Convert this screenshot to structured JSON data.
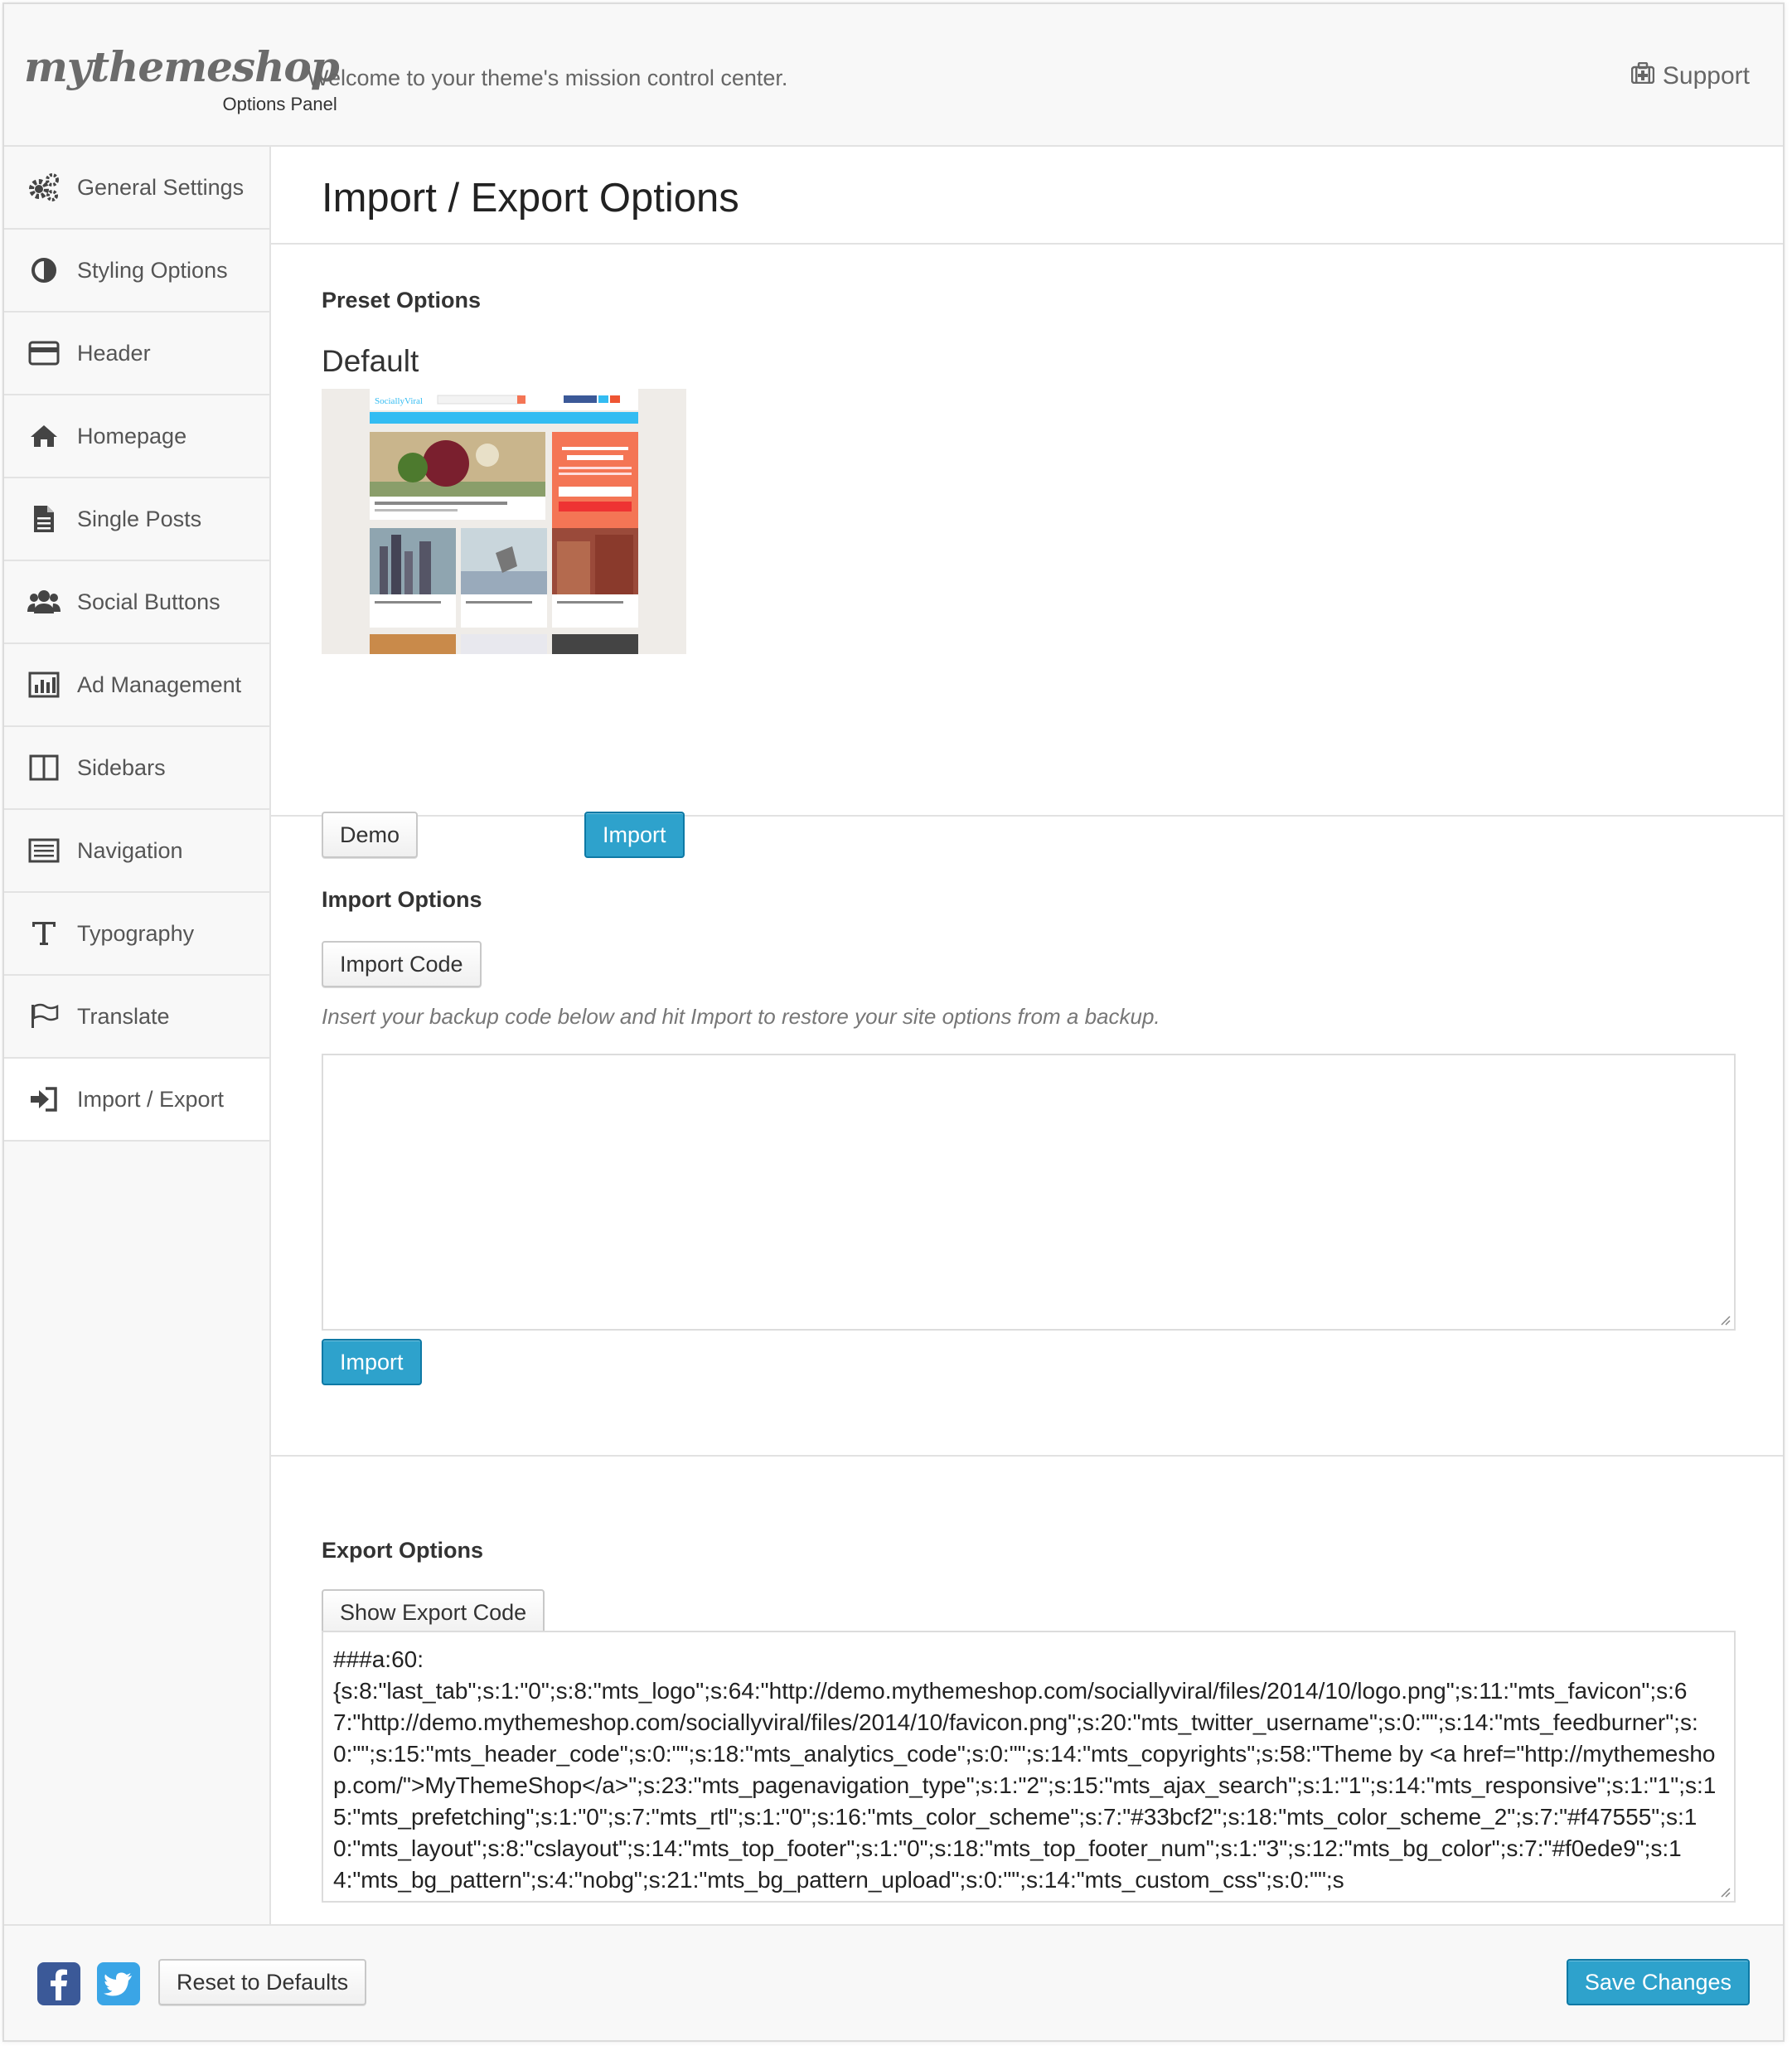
{
  "header": {
    "logo_text": "mythemeshop",
    "logo_subtitle": "Options Panel",
    "welcome": "Welcome to your theme's mission control center.",
    "support_label": "Support",
    "support_icon": "medkit-icon"
  },
  "sidebar": {
    "items": [
      {
        "label": "General Settings",
        "icon": "cogs-icon"
      },
      {
        "label": "Styling Options",
        "icon": "contrast-icon"
      },
      {
        "label": "Header",
        "icon": "credit-card-icon"
      },
      {
        "label": "Homepage",
        "icon": "home-icon"
      },
      {
        "label": "Single Posts",
        "icon": "document-icon"
      },
      {
        "label": "Social Buttons",
        "icon": "users-icon"
      },
      {
        "label": "Ad Management",
        "icon": "bar-chart-icon"
      },
      {
        "label": "Sidebars",
        "icon": "columns-icon"
      },
      {
        "label": "Navigation",
        "icon": "list-icon"
      },
      {
        "label": "Typography",
        "icon": "text-icon"
      },
      {
        "label": "Translate",
        "icon": "flag-icon"
      },
      {
        "label": "Import / Export",
        "icon": "sign-in-icon"
      }
    ],
    "active_index": 11
  },
  "main": {
    "title": "Import / Export Options",
    "preset": {
      "section_label": "Preset Options",
      "preset_name": "Default",
      "thumbnail_site_name": "SociallyViral",
      "demo_label": "Demo",
      "import_label": "Import"
    },
    "import": {
      "section_label": "Import Options",
      "import_code_label": "Import Code",
      "note": "Insert your backup code below and hit Import to restore your site options from a backup.",
      "textarea_value": "",
      "import_label": "Import"
    },
    "export": {
      "section_label": "Export Options",
      "show_label": "Show Export Code",
      "code": "###a:60:\n{s:8:\"last_tab\";s:1:\"0\";s:8:\"mts_logo\";s:64:\"http://demo.mythemeshop.com/sociallyviral/files/2014/10/logo.png\";s:11:\"mts_favicon\";s:67:\"http://demo.mythemeshop.com/sociallyviral/files/2014/10/favicon.png\";s:20:\"mts_twitter_username\";s:0:\"\";s:14:\"mts_feedburner\";s:0:\"\";s:15:\"mts_header_code\";s:0:\"\";s:18:\"mts_analytics_code\";s:0:\"\";s:14:\"mts_copyrights\";s:58:\"Theme by <a href=\"http://mythemeshop.com/\">MyThemeShop</a>\";s:23:\"mts_pagenavigation_type\";s:1:\"2\";s:15:\"mts_ajax_search\";s:1:\"1\";s:14:\"mts_responsive\";s:1:\"1\";s:15:\"mts_prefetching\";s:1:\"0\";s:7:\"mts_rtl\";s:1:\"0\";s:16:\"mts_color_scheme\";s:7:\"#33bcf2\";s:18:\"mts_color_scheme_2\";s:7:\"#f47555\";s:10:\"mts_layout\";s:8:\"cslayout\";s:14:\"mts_top_footer\";s:1:\"0\";s:18:\"mts_top_footer_num\";s:1:\"3\";s:12:\"mts_bg_color\";s:7:\"#f0ede9\";s:14:\"mts_bg_pattern\";s:4:\"nobg\";s:21:\"mts_bg_pattern_upload\";s:0:\"\";s:14:\"mts_custom_css\";s:0:\"\";s"
    }
  },
  "footer": {
    "facebook_icon": "facebook-icon",
    "twitter_icon": "twitter-icon",
    "reset_label": "Reset to Defaults",
    "save_label": "Save Changes"
  },
  "colors": {
    "primary_button": "#2ea2cc",
    "facebook": "#3b5998",
    "twitter": "#3aa5e6"
  }
}
